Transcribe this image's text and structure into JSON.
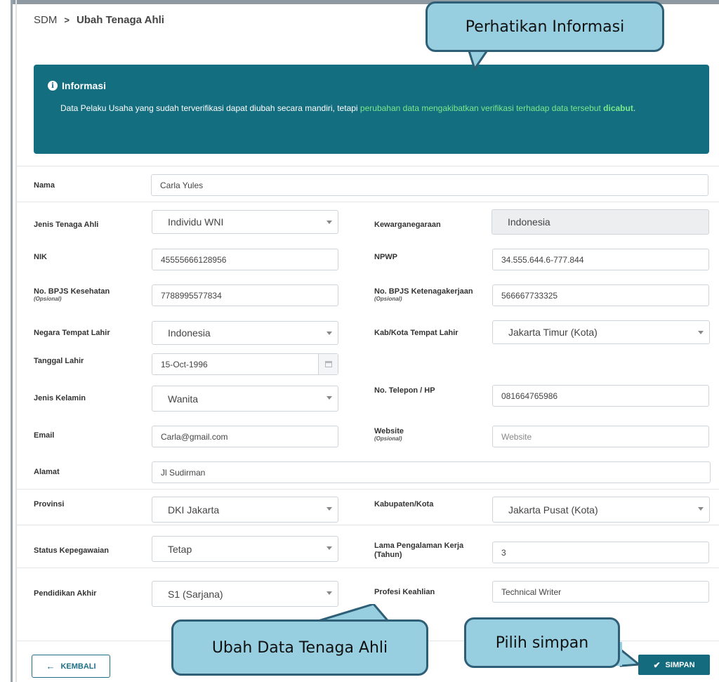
{
  "breadcrumb": {
    "root": "SDM",
    "separator": ">",
    "current": "Ubah Tenaga Ahli"
  },
  "info": {
    "title": "Informasi",
    "text_plain": "Data Pelaku Usaha yang sudah terverifikasi dapat diubah secara mandiri, tetapi ",
    "text_highlight": "perubahan data mengakibatkan verifikasi terhadap data tersebut",
    "text_highlight_bold": "dicabut",
    "text_end": "."
  },
  "form": {
    "nama": {
      "label": "Nama",
      "value": "Carla Yules"
    },
    "jenis_tenaga_ahli": {
      "label": "Jenis Tenaga Ahli",
      "value": "Individu WNI"
    },
    "kewarganegaraan": {
      "label": "Kewarganegaraan",
      "value": "Indonesia"
    },
    "nik": {
      "label": "NIK",
      "value": "45555666128956"
    },
    "npwp": {
      "label": "NPWP",
      "value": "34.555.644.6-777.844"
    },
    "bpjs_kesehatan": {
      "label": "No. BPJS Kesehatan",
      "optional": "(Opsional)",
      "value": "7788995577834"
    },
    "bpjs_ketenagakerjaan": {
      "label": "No. BPJS Ketenagakerjaan",
      "optional": "(Opsional)",
      "value": "566667733325"
    },
    "negara_tempat_lahir": {
      "label": "Negara Tempat Lahir",
      "value": "Indonesia"
    },
    "kab_kota_tempat_lahir": {
      "label": "Kab/Kota Tempat Lahir",
      "value": "Jakarta Timur (Kota)"
    },
    "tanggal_lahir": {
      "label": "Tanggal Lahir",
      "value": "15-Oct-1996"
    },
    "jenis_kelamin": {
      "label": "Jenis Kelamin",
      "value": "Wanita"
    },
    "telepon": {
      "label": "No. Telepon / HP",
      "value": "081664765986"
    },
    "email": {
      "label": "Email",
      "value": "Carla@gmail.com"
    },
    "website": {
      "label": "Website",
      "optional": "(Opsional)",
      "placeholder": "Website"
    },
    "alamat": {
      "label": "Alamat",
      "value": "Jl Sudirman"
    },
    "provinsi": {
      "label": "Provinsi",
      "value": "DKI Jakarta"
    },
    "kabupaten_kota": {
      "label": "Kabupaten/Kota",
      "value": "Jakarta Pusat (Kota)"
    },
    "status_kepegawaian": {
      "label": "Status Kepegawaian",
      "value": "Tetap"
    },
    "lama_pengalaman": {
      "label": "Lama Pengalaman Kerja",
      "label2": "(Tahun)",
      "value": "3"
    },
    "pendidikan_akhir": {
      "label": "Pendidikan Akhir",
      "value": "S1 (Sarjana)"
    },
    "profesi_keahlian": {
      "label": "Profesi Keahlian",
      "value": "Technical Writer"
    }
  },
  "buttons": {
    "back": "KEMBALI",
    "save": "SIMPAN"
  },
  "callouts": {
    "top": "Perhatikan Informasi",
    "bottom_center": "Ubah Data Tenaga Ahli",
    "bottom_right": "Pilih simpan"
  },
  "colors": {
    "primary": "#136e80",
    "highlight": "#7be88a",
    "callout_fill": "#97cfe0",
    "callout_border": "#2f5f76"
  }
}
